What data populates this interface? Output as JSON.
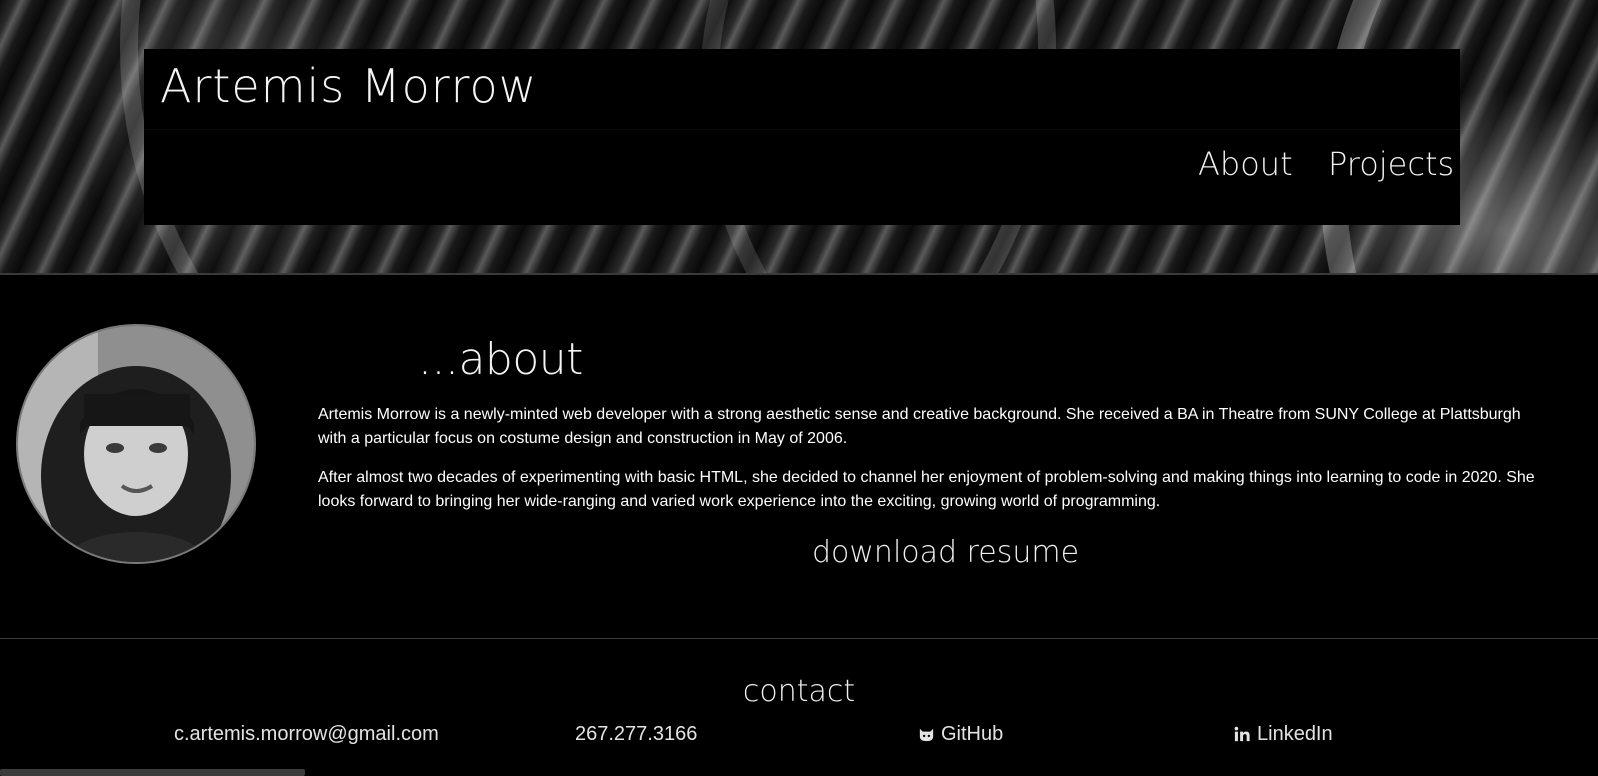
{
  "header": {
    "site_title": "Artemis Morrow",
    "nav": [
      {
        "label": "About"
      },
      {
        "label": "Projects"
      }
    ]
  },
  "about": {
    "heading": "...about",
    "paragraphs": [
      "Artemis Morrow is a newly-minted web developer with a strong aesthetic sense and creative background. She received a BA in Theatre from SUNY College at Plattsburgh with a particular focus on costume design and construction in May of 2006.",
      "After almost two decades of experimenting with basic HTML, she decided to channel her enjoyment of problem-solving and making things into learning to code in 2020. She looks forward to bringing her wide-ranging and varied work experience into the exciting, growing world of programming."
    ],
    "resume_label": "download resume"
  },
  "contact": {
    "heading": "contact",
    "email": "c.artemis.morrow@gmail.com",
    "phone": "267.277.3166",
    "github_label": "GitHub",
    "github_icon": "github-icon",
    "linkedin_label": "LinkedIn",
    "linkedin_icon": "linkedin-icon"
  },
  "colors": {
    "background": "#000000",
    "text": "#ffffff",
    "divider": "#3b3b3b"
  }
}
